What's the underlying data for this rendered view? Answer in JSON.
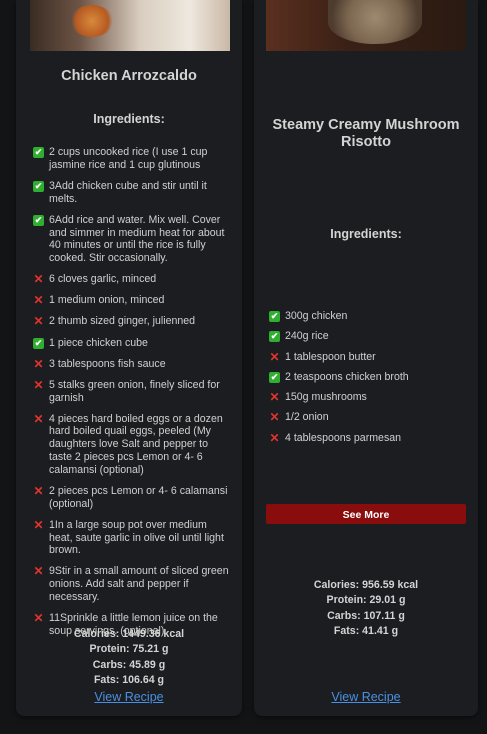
{
  "recipes": [
    {
      "title": "Chicken Arrozcaldo",
      "ingredients_heading": "Ingredients:",
      "ingredients": [
        {
          "text": "2 cups uncooked rice (I use 1 cup jasmine rice and 1 cup glutinous",
          "have": true
        },
        {
          "text": "3Add chicken cube and stir until it melts.",
          "have": true
        },
        {
          "text": "6Add rice and water. Mix well. Cover and simmer in medium heat for about 40 minutes or until the rice is fully cooked. Stir occasionally.",
          "have": true
        },
        {
          "text": "6 cloves garlic, minced",
          "have": false
        },
        {
          "text": "1 medium onion, minced",
          "have": false
        },
        {
          "text": "2 thumb sized ginger, julienned",
          "have": false
        },
        {
          "text": "1 piece chicken cube",
          "have": true
        },
        {
          "text": "3 tablespoons fish sauce",
          "have": false
        },
        {
          "text": "5 stalks green onion, finely sliced for garnish",
          "have": false
        },
        {
          "text": "4 pieces hard boiled eggs or a dozen hard boiled quail eggs, peeled (My daughters love Salt and pepper to taste 2 pieces pcs Lemon or 4- 6 calamansi (optional)",
          "have": false
        },
        {
          "text": "2 pieces pcs Lemon or 4- 6 calamansi (optional)",
          "have": false
        },
        {
          "text": "1In a large soup pot over medium heat, saute garlic in olive oil until light brown.",
          "have": false
        },
        {
          "text": "9Stir in a small amount of sliced green onions. Add salt and pepper if necessary.",
          "have": false
        },
        {
          "text": "11Sprinkle a little lemon juice on the soup servings. (optional)",
          "have": false
        }
      ],
      "nutrition": {
        "calories": "Calories: 1449.36 kcal",
        "protein": "Protein: 75.21 g",
        "carbs": "Carbs: 45.89 g",
        "fats": "Fats: 106.64 g"
      },
      "view_label": "View Recipe"
    },
    {
      "title": "Steamy Creamy Mushroom Risotto",
      "ingredients_heading": "Ingredients:",
      "ingredients": [
        {
          "text": "300g chicken",
          "have": true
        },
        {
          "text": "240g rice",
          "have": true
        },
        {
          "text": "1 tablespoon butter",
          "have": false
        },
        {
          "text": "2 teaspoons chicken broth",
          "have": true
        },
        {
          "text": "150g mushrooms",
          "have": false
        },
        {
          "text": "1/2 onion",
          "have": false
        },
        {
          "text": "4 tablespoons parmesan",
          "have": false
        }
      ],
      "see_more_label": "See More",
      "nutrition": {
        "calories": "Calories: 956.59 kcal",
        "protein": "Protein: 29.01 g",
        "carbs": "Carbs: 107.11 g",
        "fats": "Fats: 41.41 g"
      },
      "view_label": "View Recipe"
    }
  ],
  "icons": {
    "have": "checkmark-icon",
    "missing": "cross-icon"
  },
  "colors": {
    "have": "#2fae2f",
    "missing": "#e0342c",
    "see_more_bg": "#8a0d0d",
    "link": "#4a90e2"
  }
}
